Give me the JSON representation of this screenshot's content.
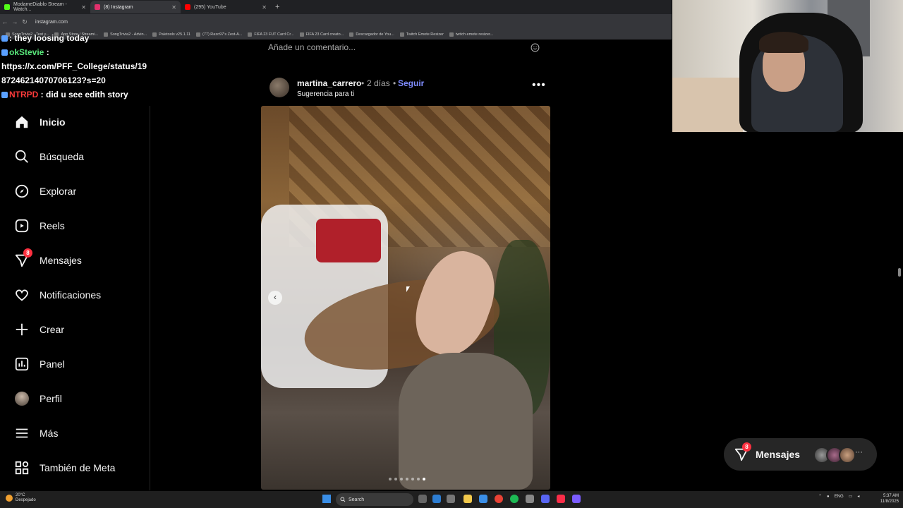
{
  "browser": {
    "tabs": [
      {
        "label": "ModameDiablo Stream - Watch...",
        "color": "#53fc18"
      },
      {
        "label": "(8) Instagram",
        "color": "#e1306c"
      },
      {
        "label": "(295) YouTube",
        "color": "#ff0000"
      }
    ],
    "new_tab": "+",
    "url": "instagram.com",
    "bookmarks": [
      "SongTrivia2 - Test y...",
      "App Store / Streami...",
      "SongTrivia2 - Advin...",
      "Paletools v25.1.11",
      "(77) Razo97's Zest-A...",
      "FIFA 23 FUT Card Cr...",
      "FIFA 23 Card creato...",
      "Descargador de You...",
      "Twitch Emote Resizer",
      "twitch emote resizer..."
    ]
  },
  "chat": {
    "line0": ": they loosing today",
    "line1_user": "okStevie",
    "line1_sep": " :",
    "line2": "https://x.com/PFF_College/status/1987246214070706123?s=20",
    "line3_user": "NTRPD",
    "line3_msg": " : did u see edith story"
  },
  "sidebar": {
    "items": [
      {
        "label": "Inicio",
        "icon": "home-icon"
      },
      {
        "label": "Búsqueda",
        "icon": "search-icon"
      },
      {
        "label": "Explorar",
        "icon": "compass-icon"
      },
      {
        "label": "Reels",
        "icon": "reels-icon"
      },
      {
        "label": "Mensajes",
        "icon": "messenger-icon",
        "badge": "8"
      },
      {
        "label": "Notificaciones",
        "icon": "heart-icon"
      },
      {
        "label": "Crear",
        "icon": "plus-icon"
      },
      {
        "label": "Panel",
        "icon": "chart-icon"
      },
      {
        "label": "Perfil",
        "icon": "avatar-icon"
      },
      {
        "label": "Más",
        "icon": "menu-icon"
      },
      {
        "label": "También de Meta",
        "icon": "meta-apps-icon"
      }
    ]
  },
  "feed": {
    "comment_placeholder": "Añade un comentario...",
    "post": {
      "username": "martina_carrero",
      "separator": "•",
      "time": "2 días",
      "follow": "Seguir",
      "subtitle": "Sugerencia para ti",
      "more": "•••",
      "carousel_prev": "‹",
      "carousel_dots": 7,
      "carousel_active": 6
    }
  },
  "messages_pill": {
    "label": "Mensajes",
    "badge": "8",
    "more": "···"
  },
  "taskbar": {
    "temp": "20°C",
    "weather": "Despejado",
    "search": "Search",
    "lang": "ENG",
    "time": "5:37 AM",
    "date": "11/8/2025"
  },
  "colors": {
    "accent_follow": "#7f8cff",
    "badge_red": "#ff3040",
    "bg": "#000000"
  }
}
